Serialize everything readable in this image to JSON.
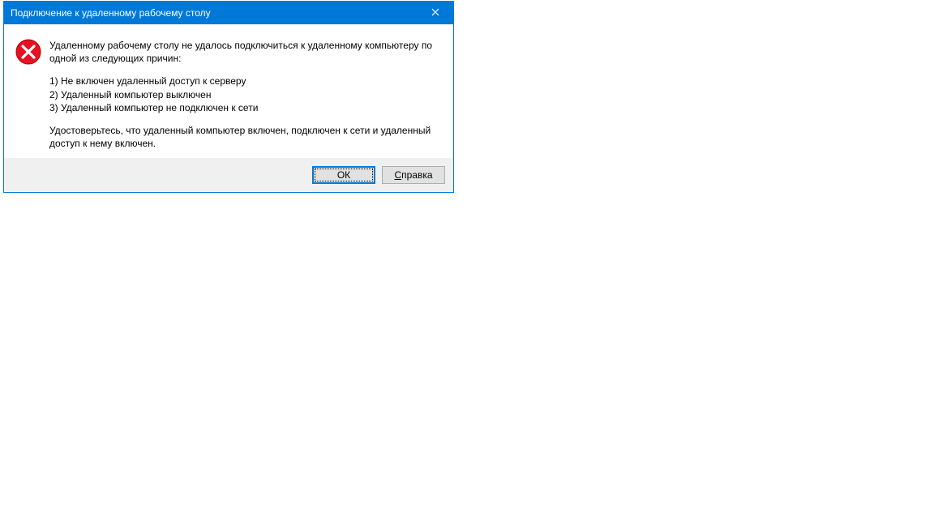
{
  "dialog": {
    "title": "Подключение к удаленному рабочему столу",
    "message_intro": "Удаленному рабочему столу не удалось подключиться к удаленному компьютеру по одной из следующих причин:",
    "reason1": "1) Не включен удаленный доступ к серверу",
    "reason2": "2) Удаленный компьютер выключен",
    "reason3": "3) Удаленный компьютер не подключен к сети",
    "message_advice": "Удостоверьтесь, что удаленный компьютер включен, подключен к сети и удаленный доступ к нему включен.",
    "ok_label": "ОК",
    "help_accel": "С",
    "help_rest": "правка"
  }
}
